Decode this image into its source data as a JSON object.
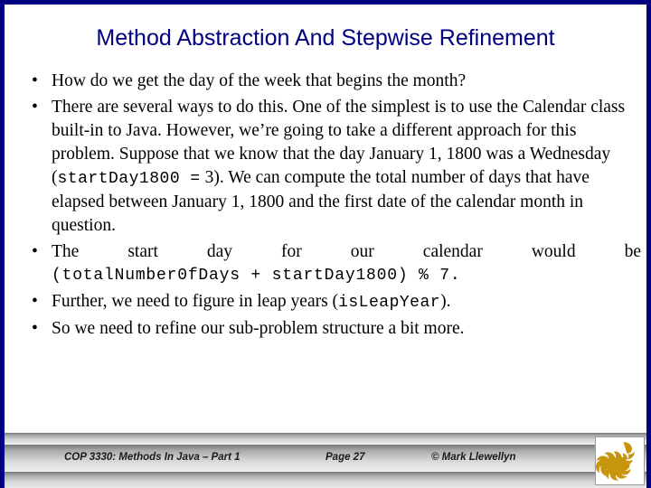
{
  "slide": {
    "title": "Method Abstraction And Stepwise Refinement",
    "title_color": "#000080",
    "border_color": "#000080",
    "background": "#ffffff"
  },
  "bullets": [
    {
      "marker": "•",
      "text": "How do we get the day of the week that begins the month?"
    },
    {
      "marker": "•",
      "part1": "There are several ways to do this.  One of the simplest is to use the Calendar class built-in to Java.  However, we’re going to take a different approach for this problem.  Suppose that we know that the day January 1, 1800 was a Wednesday (",
      "code1": "startDay1800 =",
      "part2": " 3).  We can compute the total number of days that have elapsed between January 1, 1800 and the first date of the calendar month in question."
    },
    {
      "marker": "•",
      "line1": "The start day for our calendar would be",
      "code_line": "(totalNumber0fDays + startDay1800) % 7."
    },
    {
      "marker": "•",
      "part1": "Further, we need to figure in leap years (",
      "code1": "isLeapYear",
      "part2": ")."
    },
    {
      "marker": "•",
      "text": "So we need to refine our sub-problem structure a bit more."
    }
  ],
  "footer": {
    "course": "COP 3330:  Methods In Java – Part 1",
    "page": "Page 27",
    "credit": "© Mark Llewellyn",
    "logo_name": "ucf-pegasus-logo",
    "logo_color": "#c8960c"
  }
}
